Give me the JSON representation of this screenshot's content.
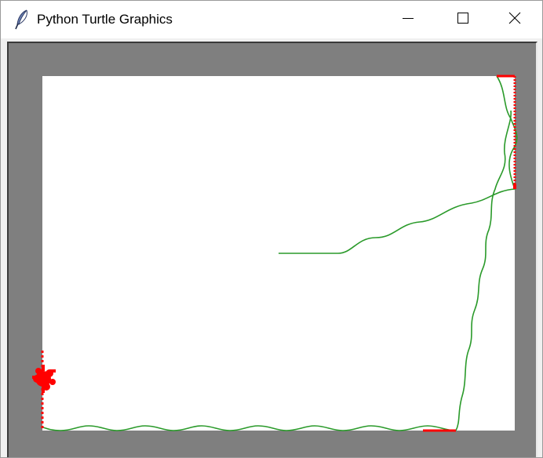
{
  "window": {
    "title": "Python Turtle Graphics",
    "icon": "feather-icon",
    "controls": [
      "minimize-icon",
      "maximize-icon",
      "close-icon"
    ]
  },
  "canvas": {
    "background": "#ffffff",
    "frame_color": "#7f7f7f",
    "path_color": "#2a9a2a",
    "wall_hit_color": "#ff0000"
  }
}
